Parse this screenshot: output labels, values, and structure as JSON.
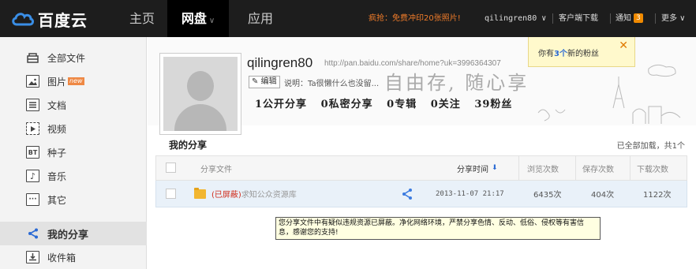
{
  "topbar": {
    "logo_text": "百度云",
    "nav": [
      {
        "label": "主页"
      },
      {
        "label": "网盘",
        "caret": "∨"
      },
      {
        "label": "应用"
      }
    ],
    "promo": "疯抢：免费冲印20张照片!",
    "username": "qilingren80 ∨",
    "client_download": "客户端下载",
    "notification": "通知",
    "notification_count": "3",
    "more": "更多 ∨"
  },
  "sidebar": {
    "items": [
      {
        "label": "全部文件",
        "icon": "folder-icon"
      },
      {
        "label": "图片",
        "icon": "image-icon",
        "badge": "new"
      },
      {
        "label": "文档",
        "icon": "document-icon"
      },
      {
        "label": "视频",
        "icon": "video-icon"
      },
      {
        "label": "种子",
        "icon": "bt-icon",
        "glyph": "BT"
      },
      {
        "label": "音乐",
        "icon": "music-icon",
        "glyph": "♪"
      },
      {
        "label": "其它",
        "icon": "other-icon",
        "glyph": "···"
      },
      {
        "label": "我的分享",
        "icon": "share-icon",
        "active": true
      },
      {
        "label": "收件箱",
        "icon": "inbox-icon"
      }
    ]
  },
  "profile": {
    "username": "qilingren80",
    "url": "http://pan.baidu.com/share/home?uk=3996364307",
    "edit_label": "编辑",
    "description": "说明：Ta很懒什么也没留...",
    "slogan": "自由存, 随心享",
    "stats": [
      {
        "label": "1公开分享"
      },
      {
        "label": "0私密分享"
      },
      {
        "label": "0专辑"
      },
      {
        "label": "0关注"
      },
      {
        "label": "39粉丝"
      }
    ]
  },
  "notice": {
    "prefix": "你有",
    "count": "3个",
    "suffix": "新的粉丝",
    "close": "✕"
  },
  "shares": {
    "title": "我的分享",
    "loaded_text": "已全部加载，共1个",
    "columns": {
      "file": "分享文件",
      "time": "分享时间",
      "sort_arrow": "⬇",
      "views": "浏览次数",
      "saves": "保存次数",
      "downloads": "下载次数"
    },
    "rows": [
      {
        "status": "(已屏蔽)",
        "name": "求知公众资源库",
        "time": "2013-11-07 21:17",
        "views": "6435次",
        "saves": "404次",
        "downloads": "1122次"
      }
    ]
  },
  "tooltip": {
    "text": "您分享文件中有疑似违规资源已屏蔽。净化网络环境，严禁分享色情、反动、低俗、侵权等有害信息，感谢您的支持!"
  },
  "colors": {
    "topbar_bg": "#1d1d1d",
    "accent_blue": "#2b6ad4",
    "blocked_red": "#d02a1a",
    "promo_orange": "#f07c2a"
  }
}
